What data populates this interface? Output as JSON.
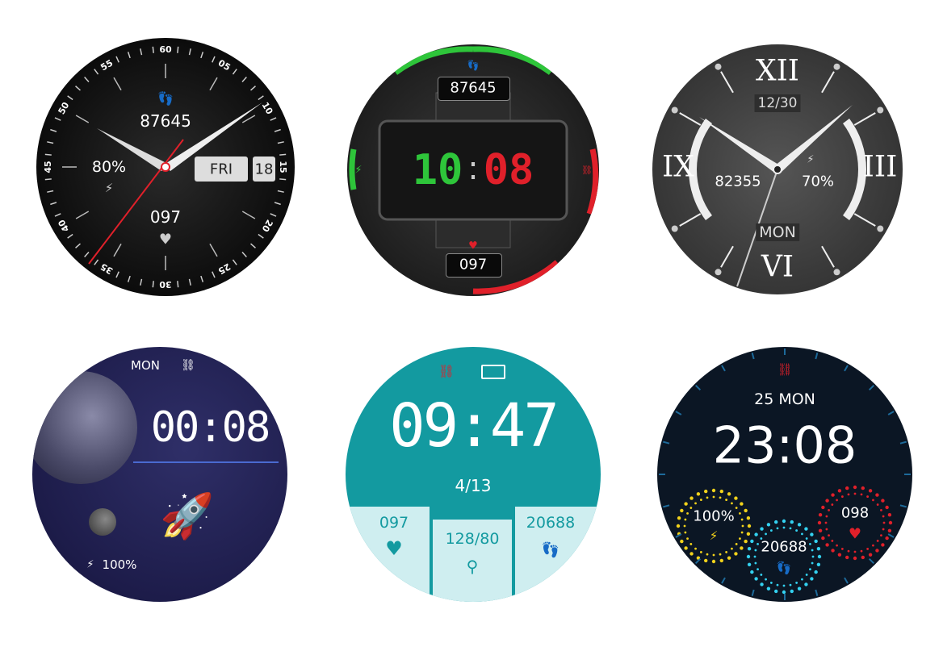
{
  "faces": [
    {
      "name": "classic-analog",
      "steps": "87645",
      "battery": "80%",
      "day": "FRI",
      "date": "18",
      "heart_rate": "097",
      "bezel_numbers": [
        "60",
        "05",
        "10",
        "15",
        "20",
        "25",
        "30",
        "35",
        "40",
        "45",
        "50",
        "55"
      ]
    },
    {
      "name": "mech-digital",
      "steps": "87645",
      "time_hours": "10",
      "time_minutes": "08",
      "heart_rate": "097"
    },
    {
      "name": "roman-analog",
      "numerals": [
        "XII",
        "III",
        "VI",
        "IX"
      ],
      "date": "12/30",
      "steps": "82355",
      "battery": "70%",
      "day": "MON"
    },
    {
      "name": "space",
      "day": "MON",
      "time": "00:08",
      "battery": "100%"
    },
    {
      "name": "teal-digital",
      "time": "09:47",
      "date": "4/13",
      "heart_rate": "097",
      "blood_pressure": "128/80",
      "steps": "20688"
    },
    {
      "name": "dotted-rings",
      "date_day": "25 MON",
      "time": "23:08",
      "battery": "100%",
      "steps": "20688",
      "heart_rate": "098"
    }
  ],
  "colors": {
    "red": "#e0202a",
    "green": "#2ec53a",
    "teal": "#139aa0",
    "teal_light": "#cfeef0",
    "navy": "#0b1624",
    "yellow": "#f2d21b",
    "cyan": "#33d1f0"
  }
}
